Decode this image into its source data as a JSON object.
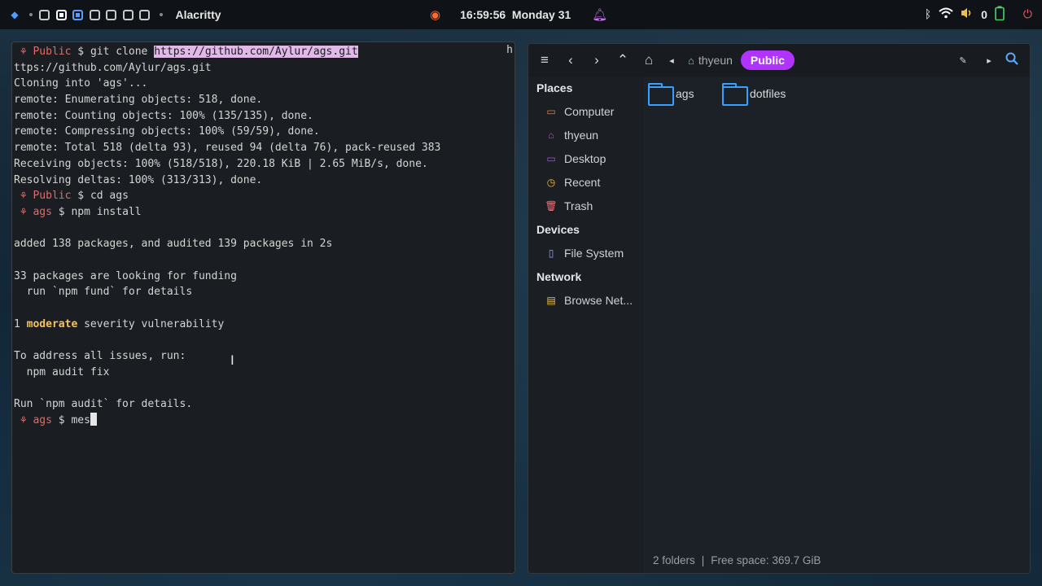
{
  "topbar": {
    "app_name": "Alacritty",
    "clock": "16:59:56",
    "date": "Monday 31",
    "battery_count": "0",
    "workspaces": [
      "1",
      "2",
      "3",
      "4",
      "5",
      "6",
      "7"
    ]
  },
  "terminal": {
    "edge_char": "h",
    "lines": [
      {
        "prompt_dir": "Public",
        "cmd_pre": "git clone ",
        "cmd_url": "https://github.com/Aylur/ags.git"
      },
      {
        "text": "ttps://github.com/Aylur/ags.git"
      },
      {
        "text": "Cloning into 'ags'..."
      },
      {
        "text": "remote: Enumerating objects: 518, done."
      },
      {
        "text": "remote: Counting objects: 100% (135/135), done."
      },
      {
        "text": "remote: Compressing objects: 100% (59/59), done."
      },
      {
        "text": "remote: Total 518 (delta 93), reused 94 (delta 76), pack-reused 383"
      },
      {
        "text": "Receiving objects: 100% (518/518), 220.18 KiB | 2.65 MiB/s, done."
      },
      {
        "text": "Resolving deltas: 100% (313/313), done."
      },
      {
        "prompt_dir": "Public",
        "cmd": "cd ags"
      },
      {
        "prompt_dir": "ags",
        "cmd": "npm install"
      },
      {
        "text": ""
      },
      {
        "text": "added 138 packages, and audited 139 packages in 2s"
      },
      {
        "text": ""
      },
      {
        "text": "33 packages are looking for funding"
      },
      {
        "text": "  run `npm fund` for details"
      },
      {
        "text": ""
      },
      {
        "vuln_num": "1 ",
        "vuln_level": "moderate",
        "vuln_rest": " severity vulnerability"
      },
      {
        "text": ""
      },
      {
        "text": "To address all issues, run:"
      },
      {
        "text": "  npm audit fix"
      },
      {
        "text": ""
      },
      {
        "text": "Run `npm audit` for details."
      },
      {
        "prompt_dir": "ags",
        "cmd": "mes"
      }
    ],
    "prompt_symbol": "$"
  },
  "filemanager": {
    "breadcrumb": {
      "home": "thyeun",
      "current": "Public"
    },
    "sidebar": {
      "places_header": "Places",
      "places": [
        {
          "label": "Computer",
          "icon": "computer-icon",
          "color": "#f07b3a"
        },
        {
          "label": "thyeun",
          "icon": "home-icon",
          "color": "#d046e0"
        },
        {
          "label": "Desktop",
          "icon": "desktop-icon",
          "color": "#b14cf0"
        },
        {
          "label": "Recent",
          "icon": "clock-icon",
          "color": "#f2c23c"
        },
        {
          "label": "Trash",
          "icon": "trash-icon",
          "color": "#ff6b7a"
        }
      ],
      "devices_header": "Devices",
      "devices": [
        {
          "label": "File System",
          "icon": "drive-icon",
          "color": "#8aa0ff"
        }
      ],
      "network_header": "Network",
      "network": [
        {
          "label": "Browse Net...",
          "icon": "network-icon",
          "color": "#f2c23c"
        }
      ]
    },
    "items": [
      {
        "name": "ags",
        "icon": "folder-icon"
      },
      {
        "name": "dotfiles",
        "icon": "folder-icon"
      }
    ],
    "status": {
      "folders": "2 folders",
      "separator": "|",
      "free_space": "Free space: 369.7 GiB"
    }
  }
}
